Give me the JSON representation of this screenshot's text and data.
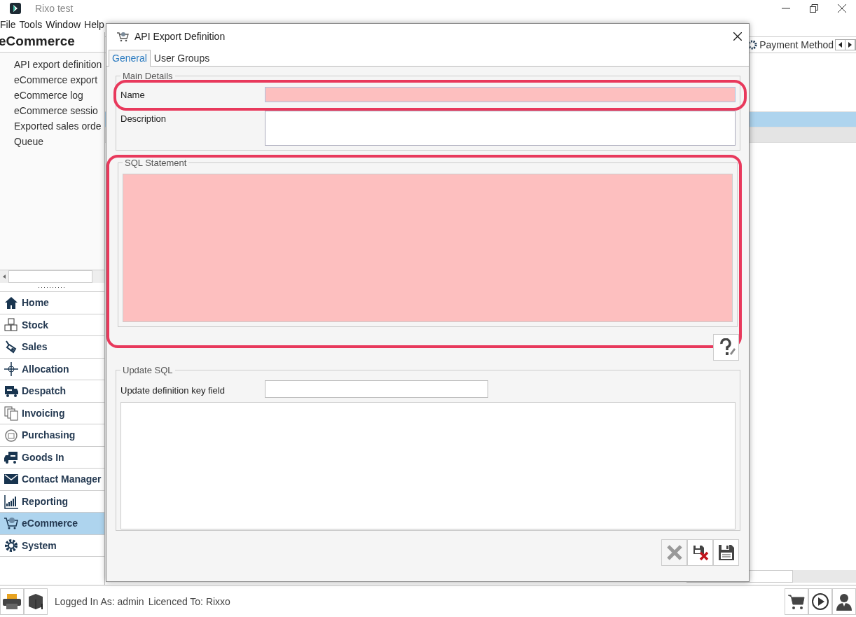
{
  "app": {
    "title": "Rixo test"
  },
  "menu": [
    {
      "label": "File"
    },
    {
      "label": "Tools"
    },
    {
      "label": "Window"
    },
    {
      "label": "Help"
    }
  ],
  "sidebar": {
    "title": "eCommerce",
    "items": [
      {
        "label": "API export definition"
      },
      {
        "label": "eCommerce export"
      },
      {
        "label": "eCommerce log"
      },
      {
        "label": "eCommerce sessio"
      },
      {
        "label": "Exported sales orde"
      },
      {
        "label": "Queue"
      }
    ]
  },
  "nav": [
    {
      "label": "Home",
      "selected": false
    },
    {
      "label": "Stock",
      "selected": false
    },
    {
      "label": "Sales",
      "selected": false
    },
    {
      "label": "Allocation",
      "selected": false
    },
    {
      "label": "Despatch",
      "selected": false
    },
    {
      "label": "Invoicing",
      "selected": false
    },
    {
      "label": "Purchasing",
      "selected": false
    },
    {
      "label": "Goods In",
      "selected": false
    },
    {
      "label": "Contact Manager",
      "selected": false
    },
    {
      "label": "Reporting",
      "selected": false
    },
    {
      "label": "eCommerce",
      "selected": true
    },
    {
      "label": "System",
      "selected": false
    }
  ],
  "right_panel": {
    "tab": "Payment Method",
    "rows": [
      {
        "selected": false
      },
      {
        "selected": true
      },
      {
        "selected": false
      }
    ]
  },
  "dialog": {
    "title": "API Export Definition",
    "tabs": [
      {
        "label": "General",
        "selected": true
      },
      {
        "label": "User Groups",
        "selected": false
      }
    ],
    "main_details": {
      "title": "Main Details",
      "fields": [
        {
          "label": "Name",
          "kind": "line",
          "invalid": true,
          "highlighted": true
        },
        {
          "label": "Description",
          "kind": "box",
          "invalid": false,
          "highlighted": false
        }
      ]
    },
    "sql_statement": {
      "title": "SQL Statement",
      "invalid": true,
      "highlighted": true
    },
    "update_sql": {
      "title": "Update SQL",
      "key_field_label": "Update definition key field"
    },
    "buttons": [
      {
        "kind": "cancel",
        "disabled": true
      },
      {
        "kind": "delete",
        "disabled": false
      },
      {
        "kind": "save",
        "disabled": false
      }
    ]
  },
  "status_bar": {
    "logged_in": "Logged In As: admin",
    "licence": "Licenced To: Rixxo"
  }
}
